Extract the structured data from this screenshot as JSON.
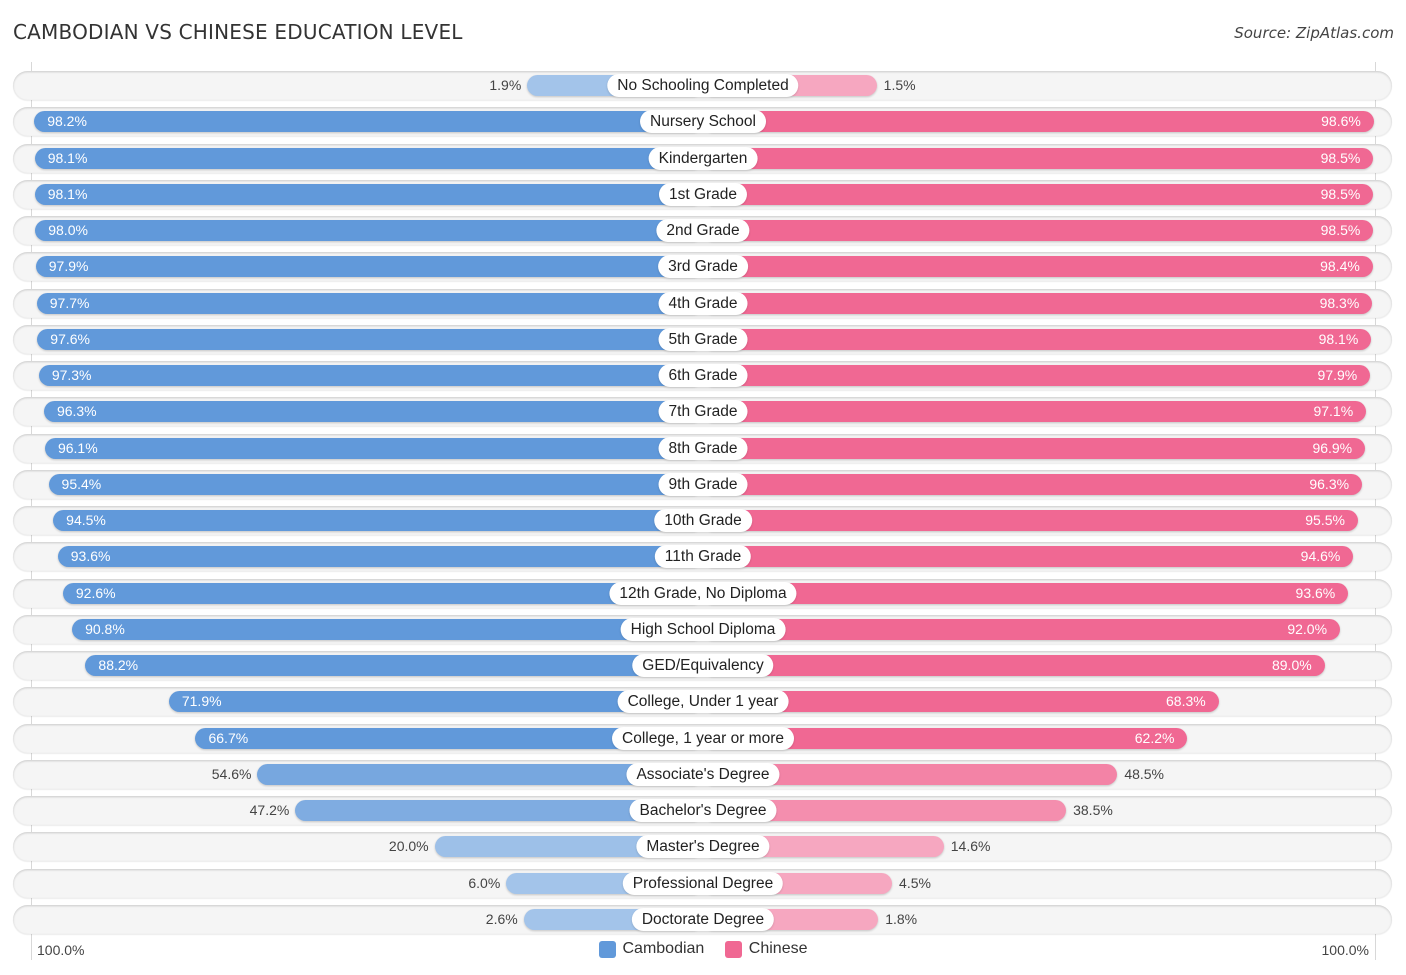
{
  "title": "CAMBODIAN VS CHINESE EDUCATION LEVEL",
  "source": "Source: ZipAtlas.com",
  "legend": [
    {
      "name": "Cambodian",
      "color": "#6199da"
    },
    {
      "name": "Chinese",
      "color": "#f06893"
    }
  ],
  "axis": {
    "left_label": "100.0%",
    "right_label": "100.0%"
  },
  "chart_data": {
    "type": "bar",
    "orientation": "horizontal-diverging",
    "title": "CAMBODIAN VS CHINESE EDUCATION LEVEL",
    "xlabel": "",
    "ylabel": "",
    "xlim": [
      0,
      100
    ],
    "legend_position": "bottom-center",
    "categories": [
      "No Schooling Completed",
      "Nursery School",
      "Kindergarten",
      "1st Grade",
      "2nd Grade",
      "3rd Grade",
      "4th Grade",
      "5th Grade",
      "6th Grade",
      "7th Grade",
      "8th Grade",
      "9th Grade",
      "10th Grade",
      "11th Grade",
      "12th Grade, No Diploma",
      "High School Diploma",
      "GED/Equivalency",
      "College, Under 1 year",
      "College, 1 year or more",
      "Associate's Degree",
      "Bachelor's Degree",
      "Master's Degree",
      "Professional Degree",
      "Doctorate Degree"
    ],
    "series": [
      {
        "name": "Cambodian",
        "color": "#6199da",
        "values": [
          1.9,
          98.2,
          98.1,
          98.1,
          98.0,
          97.9,
          97.7,
          97.6,
          97.3,
          96.3,
          96.1,
          95.4,
          94.5,
          93.6,
          92.6,
          90.8,
          88.2,
          71.9,
          66.7,
          54.6,
          47.2,
          20.0,
          6.0,
          2.6
        ],
        "labels": [
          "1.9%",
          "98.2%",
          "98.1%",
          "98.1%",
          "98.0%",
          "97.9%",
          "97.7%",
          "97.6%",
          "97.3%",
          "96.3%",
          "96.1%",
          "95.4%",
          "94.5%",
          "93.6%",
          "92.6%",
          "90.8%",
          "88.2%",
          "71.9%",
          "66.7%",
          "54.6%",
          "47.2%",
          "20.0%",
          "6.0%",
          "2.6%"
        ]
      },
      {
        "name": "Chinese",
        "color": "#f06893",
        "values": [
          1.5,
          98.6,
          98.5,
          98.5,
          98.5,
          98.4,
          98.3,
          98.1,
          97.9,
          97.1,
          96.9,
          96.3,
          95.5,
          94.6,
          93.6,
          92.0,
          89.0,
          68.3,
          62.2,
          48.5,
          38.5,
          14.6,
          4.5,
          1.8
        ],
        "labels": [
          "1.5%",
          "98.6%",
          "98.5%",
          "98.5%",
          "98.5%",
          "98.4%",
          "98.3%",
          "98.1%",
          "97.9%",
          "97.1%",
          "96.9%",
          "96.3%",
          "95.5%",
          "94.6%",
          "93.6%",
          "92.0%",
          "89.0%",
          "68.3%",
          "62.2%",
          "48.5%",
          "38.5%",
          "14.6%",
          "4.5%",
          "1.8%"
        ]
      }
    ]
  }
}
